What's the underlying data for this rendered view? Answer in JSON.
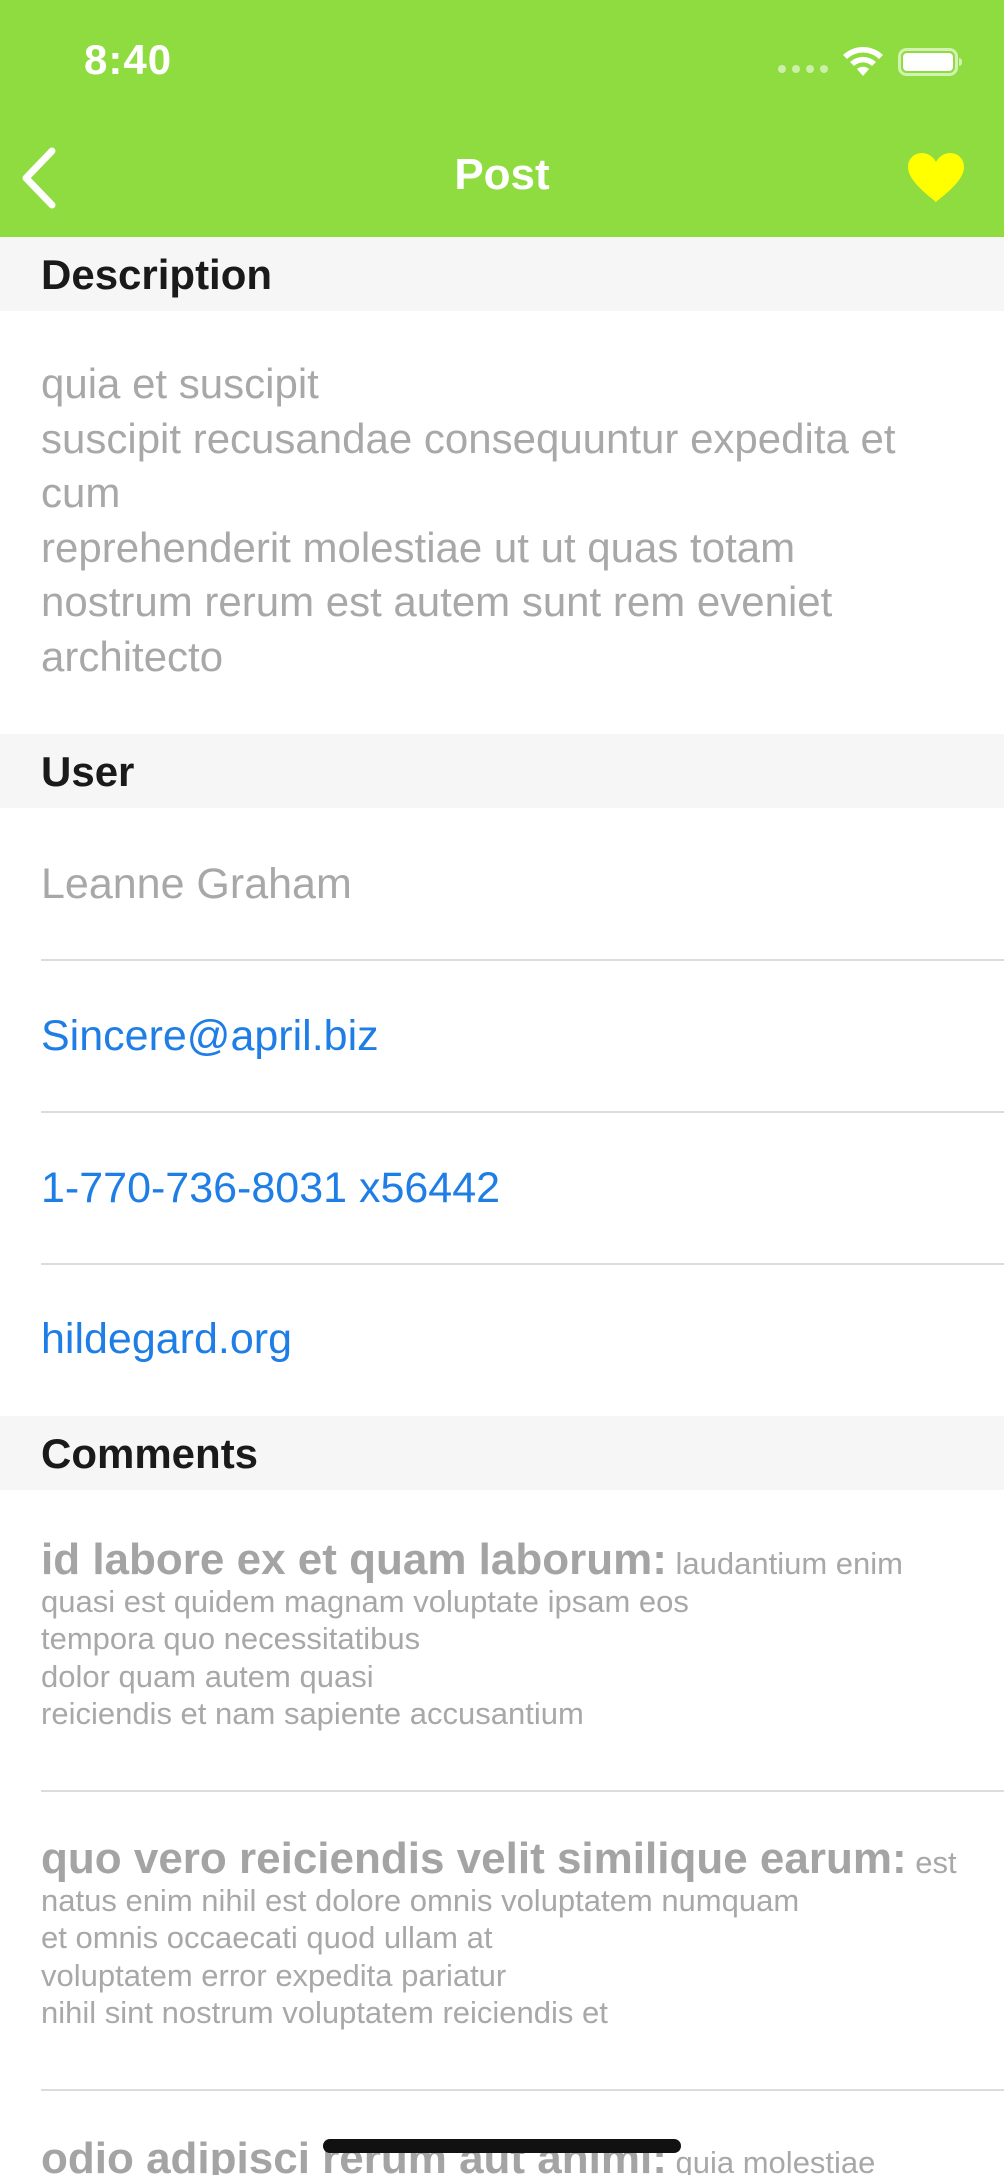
{
  "status_bar": {
    "time": "8:40",
    "icons": [
      "signal-dots-icon",
      "wifi-icon",
      "battery-icon"
    ]
  },
  "nav": {
    "title": "Post",
    "back_icon": "chevron-left-icon",
    "favorite_icon": "heart-icon"
  },
  "sections": {
    "description": "Description",
    "user": "User",
    "comments": "Comments"
  },
  "description": {
    "body": "quia et suscipit\nsuscipit recusandae consequuntur expedita et cum\nreprehenderit molestiae ut ut quas totam\nnostrum rerum est autem sunt rem eveniet architecto"
  },
  "user": {
    "name": "Leanne Graham",
    "email": "Sincere@april.biz",
    "phone": "1-770-736-8031 x56442",
    "website": "hildegard.org"
  },
  "comments": [
    {
      "title": "id labore ex et quam laborum:",
      "body": "laudantium enim quasi est quidem magnam voluptate ipsam eos\ntempora quo necessitatibus\ndolor quam autem quasi\nreiciendis et nam sapiente accusantium"
    },
    {
      "title": "quo vero reiciendis velit similique earum:",
      "body": "est natus enim nihil est dolore omnis voluptatem numquam\net omnis occaecati quod ullam at\nvoluptatem error expedita pariatur\nnihil sint nostrum voluptatem reiciendis et"
    },
    {
      "title": "odio adipisci rerum aut animi:",
      "body": "quia molestiae"
    }
  ],
  "colors": {
    "header_bg": "#8fdc41",
    "favorite": "#ffff00",
    "link": "#1f7ee6",
    "muted_text": "#a8a8a8",
    "section_bg": "#f6f6f6"
  }
}
